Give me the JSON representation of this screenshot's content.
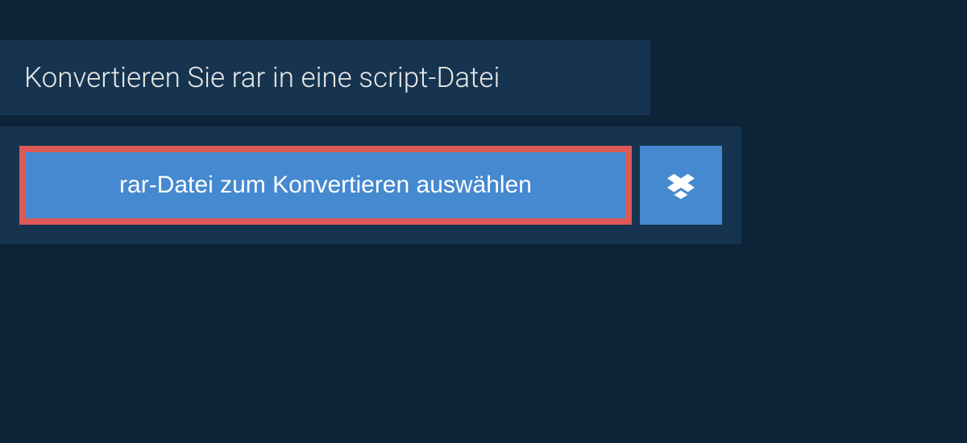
{
  "header": {
    "title": "Konvertieren Sie rar in eine script-Datei"
  },
  "actions": {
    "select_file_label": "rar-Datei zum Konvertieren auswählen",
    "dropbox_icon": "dropbox-icon"
  }
}
